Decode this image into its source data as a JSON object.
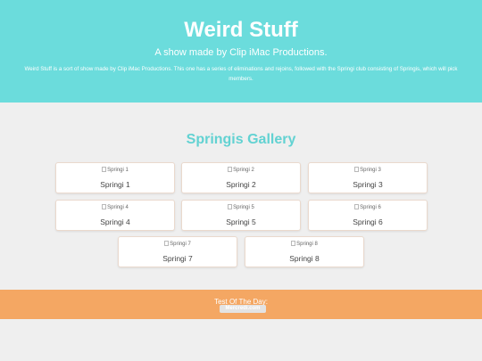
{
  "header": {
    "title": "Weird Stuff",
    "subtitle": "A show made by Clip iMac Productions.",
    "description": "Weird Stuff is a sort of show made by Clip iMac Productions. This one has a series of eliminations and rejoins, followed with the Springi club consisting of Springis, which will pick members."
  },
  "gallery": {
    "title": "Springis Gallery",
    "cards": [
      {
        "alt": "Springi 1",
        "caption": "Springi 1"
      },
      {
        "alt": "Springi 2",
        "caption": "Springi 2"
      },
      {
        "alt": "Springi 3",
        "caption": "Springi 3"
      },
      {
        "alt": "Springi 4",
        "caption": "Springi 4"
      },
      {
        "alt": "Springi 5",
        "caption": "Springi 5"
      },
      {
        "alt": "Springi 6",
        "caption": "Springi 6"
      },
      {
        "alt": "Springi 7",
        "caption": "Springi 7"
      },
      {
        "alt": "Springi 8",
        "caption": "Springi 8"
      }
    ]
  },
  "footer": {
    "label": "Test Of The Day:",
    "button": "Mercredi.com"
  },
  "colors": {
    "header_bg": "#6bdcdc",
    "accent": "#62d2d2",
    "footer_bg": "#f4a763",
    "page_bg": "#efefef"
  }
}
